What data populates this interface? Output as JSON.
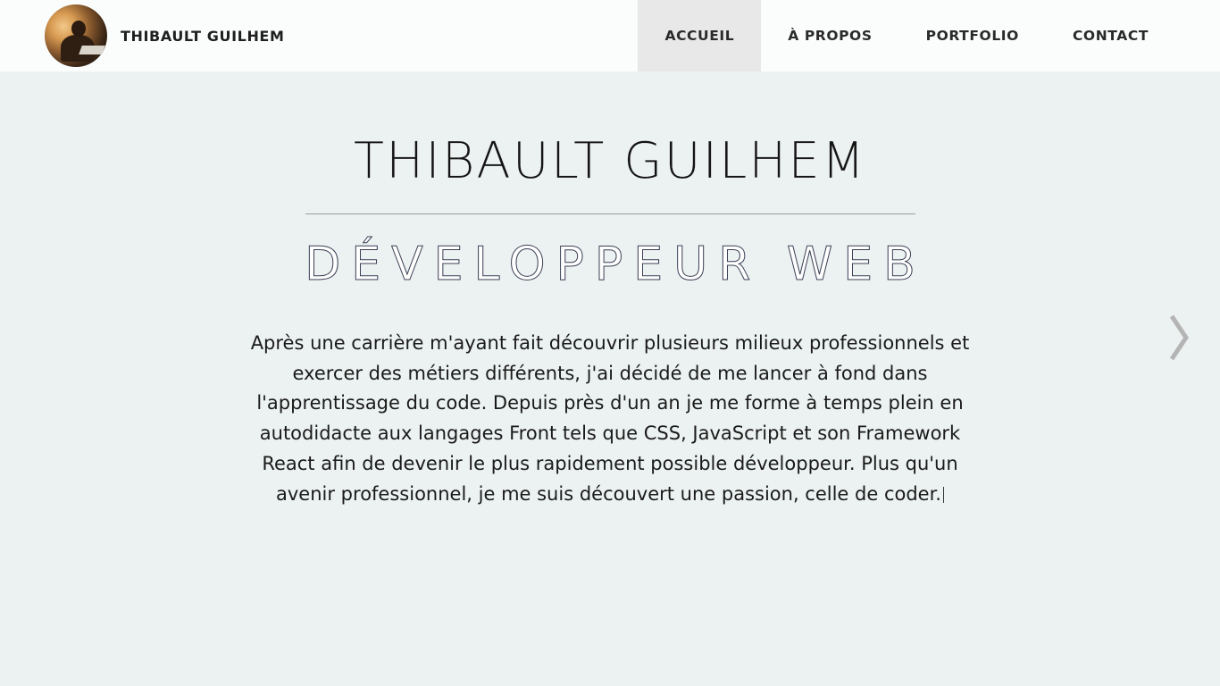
{
  "header": {
    "brand_name": "THIBAULT GUILHEM",
    "avatar_icon": "profile-photo",
    "nav": [
      {
        "label": "ACCUEIL",
        "active": true
      },
      {
        "label": "À PROPOS",
        "active": false
      },
      {
        "label": "PORTFOLIO",
        "active": false
      },
      {
        "label": "CONTACT",
        "active": false
      }
    ]
  },
  "hero": {
    "title": "THIBAULT GUILHEM",
    "subtitle": "DÉVELOPPEUR WEB",
    "bio": "Après une carrière m'ayant fait découvrir plusieurs milieux professionnels et exercer des métiers différents, j'ai décidé de me lancer à fond dans l'apprentissage du code. Depuis près d'un an je me forme à temps plein en autodidacte aux langages Front tels que CSS, JavaScript et son Framework React afin de devenir le plus rapidement possible développeur. Plus qu'un avenir professionnel, je me suis découvert une passion, celle de coder."
  },
  "controls": {
    "next_icon": "chevron-right-icon"
  },
  "colors": {
    "page_background": "#ecf2f1",
    "header_background": "#fbfdfd",
    "active_nav_background": "#e8e8e8",
    "text": "#1a1a1a",
    "subtitle_outline": "#3a3f55",
    "arrow": "#b4b4b4"
  }
}
